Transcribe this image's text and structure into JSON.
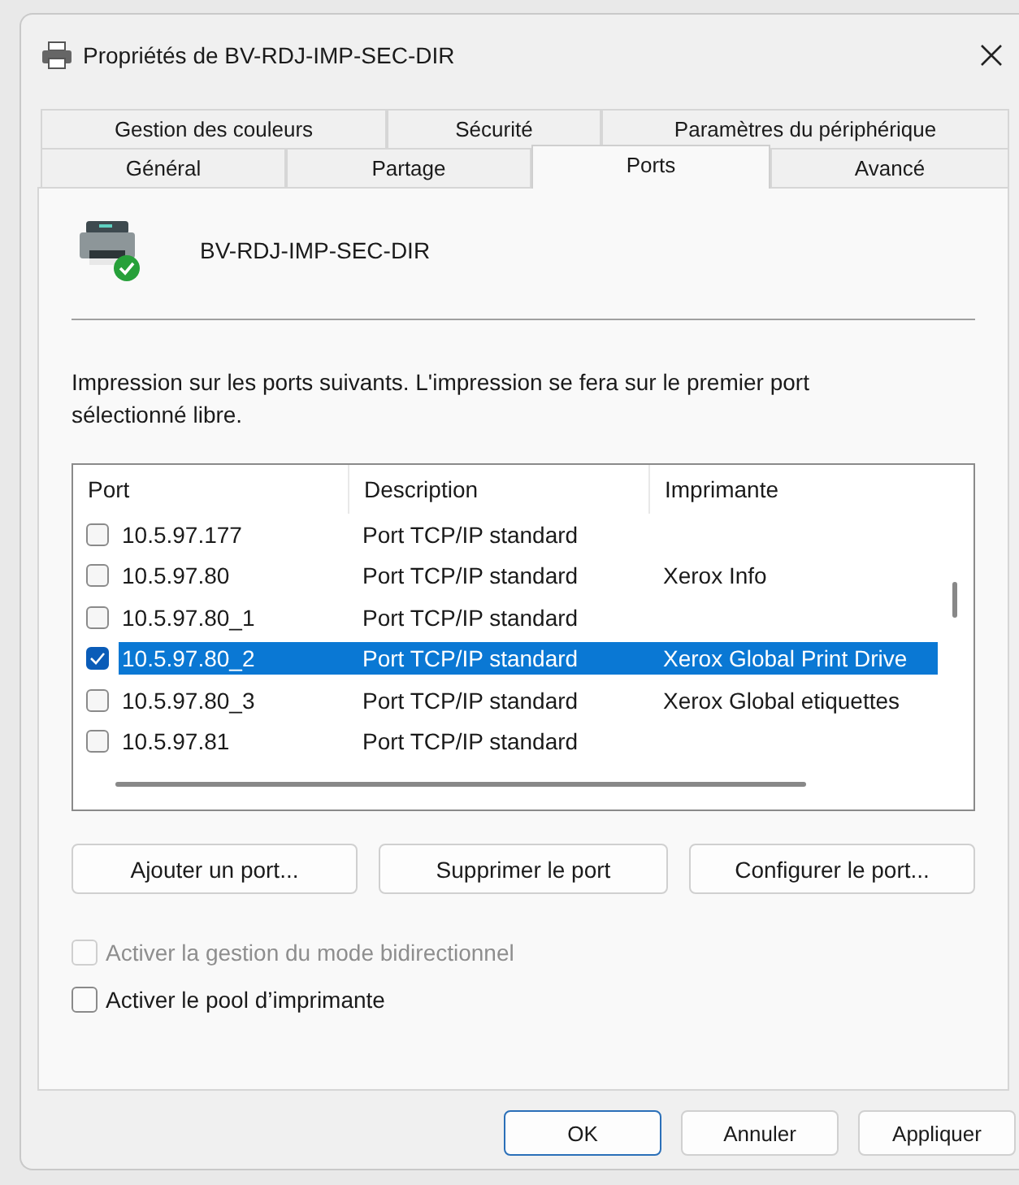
{
  "window": {
    "title": "Propriétés de BV-RDJ-IMP-SEC-DIR"
  },
  "tab_rows": [
    [
      {
        "label": "Gestion des couleurs",
        "selected": false
      },
      {
        "label": "Sécurité",
        "selected": false
      },
      {
        "label": "Paramètres du périphérique",
        "selected": false
      }
    ],
    [
      {
        "label": "Général",
        "selected": false
      },
      {
        "label": "Partage",
        "selected": false
      },
      {
        "label": "Ports",
        "selected": true
      },
      {
        "label": "Avancé",
        "selected": false
      }
    ]
  ],
  "printer_name": "BV-RDJ-IMP-SEC-DIR",
  "instructions": "Impression sur les ports suivants. L'impression se fera sur le premier port sélectionné libre.",
  "table": {
    "columns": [
      "Port",
      "Description",
      "Imprimante"
    ],
    "rows": [
      {
        "port": "10.5.97.177",
        "description": "Port TCP/IP standard",
        "printer": "",
        "checked": false,
        "selected": false
      },
      {
        "port": "10.5.97.80",
        "description": "Port TCP/IP standard",
        "printer": "Xerox Info",
        "checked": false,
        "selected": false
      },
      {
        "port": "10.5.97.80_1",
        "description": "Port TCP/IP standard",
        "printer": "",
        "checked": false,
        "selected": false
      },
      {
        "port": "10.5.97.80_2",
        "description": "Port TCP/IP standard",
        "printer": "Xerox Global Print Drive",
        "checked": true,
        "selected": true
      },
      {
        "port": "10.5.97.80_3",
        "description": "Port TCP/IP standard",
        "printer": "Xerox Global etiquettes",
        "checked": false,
        "selected": false
      },
      {
        "port": "10.5.97.81",
        "description": "Port TCP/IP standard",
        "printer": "",
        "checked": false,
        "selected": false
      }
    ]
  },
  "port_buttons": [
    "Ajouter un port...",
    "Supprimer le port",
    "Configurer le port..."
  ],
  "options": [
    {
      "label": "Activer la gestion du mode bidirectionnel",
      "checked": false,
      "disabled": true
    },
    {
      "label": "Activer le pool d’imprimante",
      "checked": false,
      "disabled": false
    }
  ],
  "dialog_buttons": [
    {
      "label": "OK",
      "default": true
    },
    {
      "label": "Annuler",
      "default": false
    },
    {
      "label": "Appliquer",
      "default": false
    }
  ]
}
